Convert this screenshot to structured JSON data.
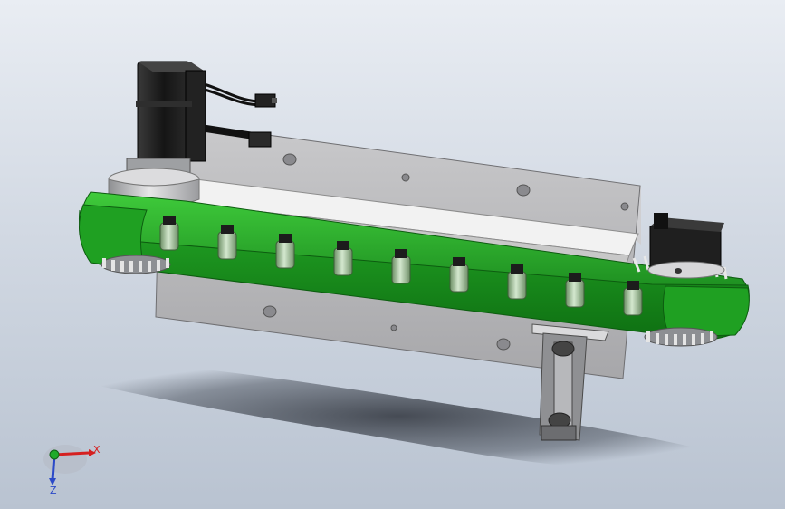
{
  "viewport": {
    "background_top": "#e9edf3",
    "background_bottom": "#b9c3d1"
  },
  "model": {
    "chain_color": "#29b52c",
    "plate_color": "#b9b9bb",
    "motor_color": "#1b1b1b",
    "roller_color": "#a7c99e"
  },
  "triad": {
    "x_label": "X",
    "z_label": "Z",
    "x_color": "#d52020",
    "y_color": "#1faa2a",
    "z_color": "#2b49c8"
  }
}
